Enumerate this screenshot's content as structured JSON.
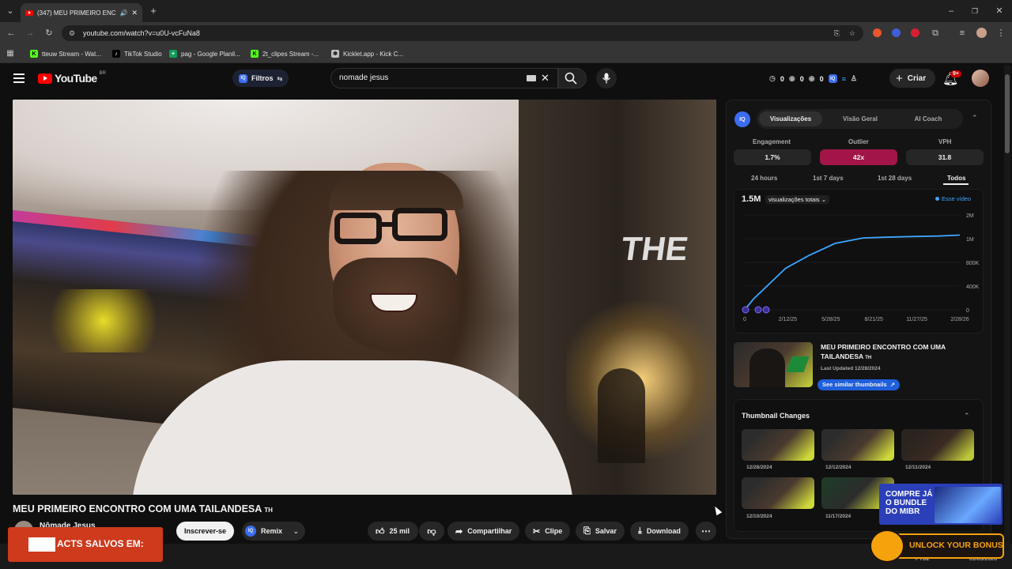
{
  "browser": {
    "tab_title": "(347) MEU PRIMEIRO ENCO",
    "url": "youtube.com/watch?v=u0U-vcFuNa8",
    "bookmarks": [
      {
        "label": "tteuw Stream - Wat...",
        "icon": "kick-icon",
        "color": "#53fc18"
      },
      {
        "label": "TikTok Studio",
        "icon": "tiktok-icon",
        "color": "#ffffff"
      },
      {
        "label": "pag - Google Planil...",
        "icon": "sheets-icon",
        "color": "#0f9d58"
      },
      {
        "label": "2t_clipes Stream -...",
        "icon": "kick-icon",
        "color": "#53fc18"
      },
      {
        "label": "Kicklet.app - Kick C...",
        "icon": "kicklet-icon",
        "color": "#c0c0c0"
      }
    ]
  },
  "header": {
    "logo_text": "YouTube",
    "logo_region": "BR",
    "filters_label": "Filtros",
    "search_value": "nomade jesus",
    "counters": [
      "0",
      "0",
      "0"
    ],
    "create_label": "Criar",
    "notif_badge": "9+"
  },
  "video": {
    "title": "MEU PRIMEIRO ENCONTRO COM UMA TAILANDESA",
    "title_suffix": "TH",
    "channel": "Nômade Jesus",
    "subscribe_label": "Inscrever-se",
    "remix_label": "Remix",
    "likes": "25 mil",
    "share_label": "Compartilhar",
    "clip_label": "Clipe",
    "save_label": "Salvar",
    "download_label": "Download"
  },
  "iq": {
    "badge": "IQ",
    "tabs": [
      "Visualizações",
      "Visão Geral",
      "AI Coach"
    ],
    "active_tab": 0,
    "metrics": [
      {
        "label": "Engagement",
        "value": "1.7%"
      },
      {
        "label": "Outlier",
        "value": "42x"
      },
      {
        "label": "VPH",
        "value": "31.8"
      }
    ],
    "ranges": [
      "24 hours",
      "1st 7 days",
      "1st 28 days",
      "Todos"
    ],
    "active_range": 3,
    "total": "1.5M",
    "dropdown": "visualizações totais",
    "legend": "Esse vídeo",
    "thumb_card": {
      "title": "MEU PRIMEIRO ENCONTRO COM UMA TAILANDESA",
      "title_suffix": "TH",
      "updated": "Last Updated 12/28/2024",
      "similar_label": "See similar thumbnails"
    },
    "thumbnail_changes": {
      "heading": "Thumbnail Changes",
      "dates": [
        "12/28/2024",
        "12/12/2024",
        "12/11/2024",
        "12/10/2024",
        "11/17/2024"
      ]
    }
  },
  "chart_data": {
    "type": "line",
    "x": [
      "0",
      "2/12/25",
      "5/28/25",
      "8/21/25",
      "11/27/25",
      "2/28/26"
    ],
    "y_ticks": [
      "0",
      "400K",
      "800K",
      "1M",
      "2M"
    ],
    "series": [
      {
        "name": "Esse vídeo",
        "values": [
          0,
          180000,
          700000,
          860000,
          960000,
          1030000,
          1060000,
          1090000,
          1110000,
          1150000
        ]
      }
    ],
    "color": "#3ea6ff"
  },
  "overlays": {
    "left_banner": "ACTS SALVOS EM:",
    "right_banner": [
      "COMPRE JÁ",
      "O BUNDLE",
      "DO MIBR"
    ],
    "unlock_label": "UNLOCK YOUR BONUS"
  },
  "taskbar": {
    "lang": "PTB2",
    "date": "01/03/2026"
  }
}
